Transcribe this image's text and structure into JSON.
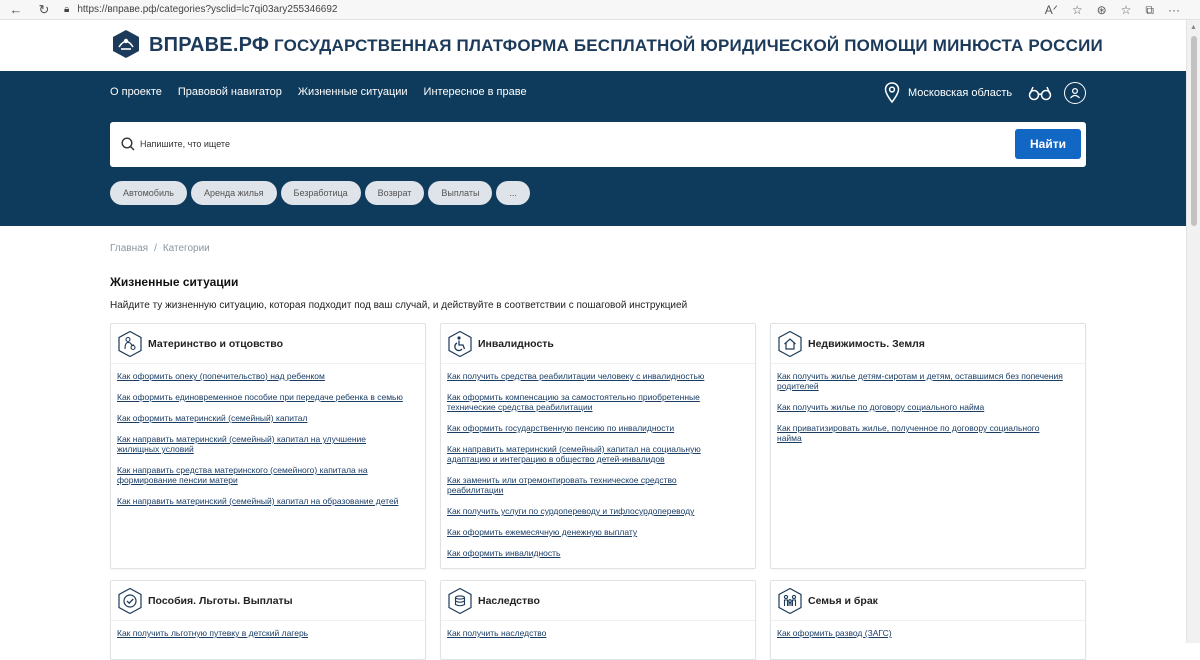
{
  "browser": {
    "url": "https://вправе.рф/categories?ysclid=lc7qi03ary255346692"
  },
  "header": {
    "logo_text": "ВПРАВЕ.РФ",
    "platform_title": "ГОСУДАРСТВЕННАЯ ПЛАТФОРМА БЕСПЛАТНОЙ ЮРИДИЧЕСКОЙ ПОМОЩИ МИНЮСТА РОССИИ"
  },
  "nav": {
    "items": [
      "О проекте",
      "Правовой навигатор",
      "Жизненные ситуации",
      "Интересное в праве"
    ],
    "region": "Московская область"
  },
  "search": {
    "placeholder": "Напишите, что ищете",
    "button": "Найти"
  },
  "chips": [
    "Автомобиль",
    "Аренда жилья",
    "Безработица",
    "Возврат",
    "Выплаты",
    "..."
  ],
  "breadcrumb": {
    "home": "Главная",
    "separator": "/",
    "current": "Категории"
  },
  "page": {
    "title": "Жизненные ситуации",
    "subtitle": "Найдите ту жизненную ситуацию, которая подходит под ваш случай, и действуйте в соответствии с пошаговой инструкцией"
  },
  "cards": [
    {
      "title": "Материнство и отцовство",
      "icon": "mother-child-icon",
      "links": [
        "Как оформить опеку (попечительство) над ребенком",
        "Как оформить единовременное пособие при передаче ребенка в семью",
        "Как оформить материнский (семейный) капитал",
        "Как направить материнский (семейный) капитал на улучшение жилищных условий",
        "Как направить средства материнского (семейного) капитала на формирование пенсии матери",
        "Как направить материнский (семейный) капитал на образование детей"
      ]
    },
    {
      "title": "Инвалидность",
      "icon": "wheelchair-icon",
      "links": [
        "Как получить средства реабилитации человеку с инвалидностью",
        "Как оформить компенсацию за самостоятельно приобретенные технические средства реабилитации",
        "Как оформить государственную пенсию по инвалидности",
        "Как направить материнский (семейный) капитал на социальную адаптацию и интеграцию в общество детей-инвалидов",
        "Как заменить или отремонтировать техническое средство реабилитации",
        "Как получить услуги по сурдопереводу и тифлосурдопереводу",
        "Как оформить ежемесячную денежную выплату",
        "Как оформить инвалидность"
      ]
    },
    {
      "title": "Недвижимость. Земля",
      "icon": "house-icon",
      "links": [
        "Как получить жилье детям-сиротам и детям, оставшимся без попечения родителей",
        "Как получить жилье по договору социального найма",
        "Как приватизировать жилье, полученное по договору социального найма"
      ]
    },
    {
      "title": "Пособия. Льготы. Выплаты",
      "icon": "check-circle-icon",
      "links": [
        "Как получить льготную путевку в детский лагерь"
      ]
    },
    {
      "title": "Наследство",
      "icon": "coins-icon",
      "links": [
        "Как получить наследство"
      ]
    },
    {
      "title": "Семья и брак",
      "icon": "family-icon",
      "links": [
        "Как оформить развод (ЗАГС)"
      ]
    }
  ]
}
